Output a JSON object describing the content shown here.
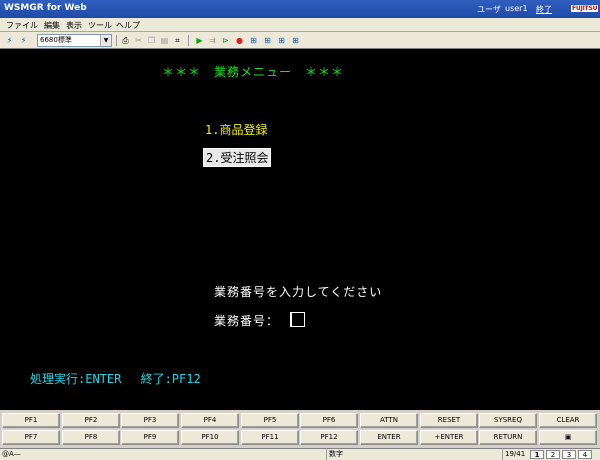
{
  "titlebar": {
    "title": "WSMGR for Web",
    "user_label": "ユーザ",
    "user_name": "user1",
    "exit_label": "終了",
    "logo": "FUJITSU"
  },
  "menu": [
    "ファイル",
    "編集",
    "表示",
    "ツール",
    "ヘルプ"
  ],
  "toolbar": {
    "code_page": "6680標準"
  },
  "screen": {
    "header": "＊＊＊　業務メニュー　＊＊＊",
    "item1": "1.商品登録",
    "item2": "2.受注照会",
    "prompt": "業務番号を入力してください",
    "field_label": "業務番号：",
    "footer": "処理実行:ENTER　 終了:PF12"
  },
  "keys_row1": [
    "PF1",
    "PF2",
    "PF3",
    "PF4",
    "PF5",
    "PF6",
    "ATTN",
    "RESET",
    "SYSREQ",
    "CLEAR"
  ],
  "keys_row2": [
    "PF7",
    "PF8",
    "PF9",
    "PF10",
    "PF11",
    "PF12",
    "ENTER",
    "+ENTER",
    "RETURN",
    "▣"
  ],
  "status": {
    "left": "@A—",
    "mode": "数字",
    "position": "19/41",
    "sessions": [
      "1",
      "2",
      "3",
      "4"
    ]
  },
  "colors": {
    "screen_bg": "#000000",
    "header": "#19e619",
    "menu_item": "#f0f000",
    "prompt": "#ffffff",
    "footer": "#18d8e8",
    "titlebar": "#1f4aa8"
  }
}
